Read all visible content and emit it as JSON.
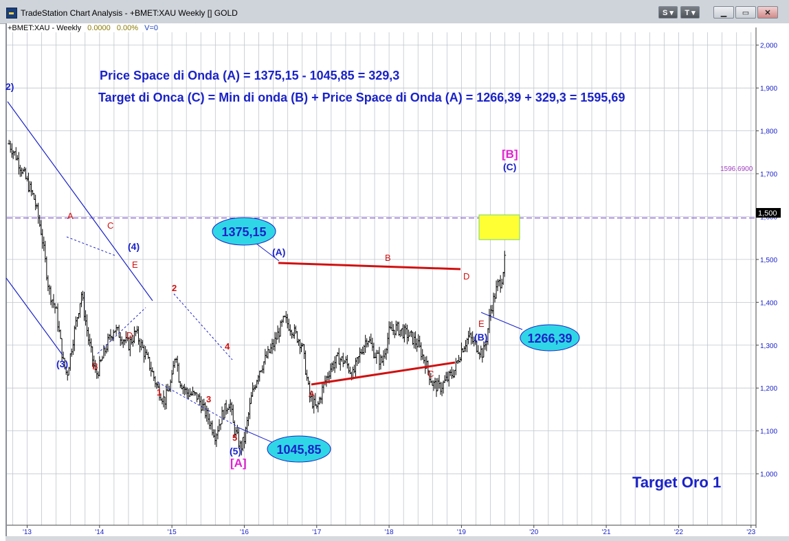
{
  "window": {
    "title": "TradeStation Chart Analysis - +BMET:XAU Weekly [] GOLD",
    "buttons": {
      "s_label": "S",
      "t_label": "T"
    }
  },
  "symbol_bar": {
    "symbol": "+BMET:XAU - Weekly",
    "price": "0.0000",
    "change": "0.00%",
    "volume": "V=0"
  },
  "colors": {
    "price_bars": "#000000",
    "grid": "#c0c4cc",
    "annotation_blue": "#1a22c8",
    "annotation_red": "#d01010",
    "annotation_magenta": "#e020d0",
    "target_line": "#8a5ad8",
    "bubble_fill": "#2fd7e6",
    "highlight_box": "#ffff33"
  },
  "annotations": {
    "formula1": "Price Space di Onda (A) = 1375,15 - 1045,85 = 329,3",
    "formula2": "Target di Onca (C) = Min di onda (B) + Price Space di Onda (A) =   1266,39 + 329,3 = 1595,69",
    "target_label": "Target Oro 1",
    "target_line_label": "1596.6900",
    "last_price_tag": "1,500",
    "bubbles": {
      "b1375": "1375,15",
      "b1045": "1045,85",
      "b1266": "1266,39"
    },
    "wave_labels": {
      "w2_top": "2)",
      "w3": "(3)",
      "w4": "(4)",
      "w5": "(5)",
      "bigA": "[A]",
      "bigB": "[B]",
      "waveA": "(A)",
      "waveB": "(B)",
      "waveC": "(C)",
      "s_A": "A",
      "s_B": "B",
      "s_C": "C",
      "s_D": "D",
      "s_E": "E",
      "n1": "1",
      "n2": "2",
      "n3": "3",
      "n4": "4",
      "n5": "5",
      "t_A": "A",
      "t_B": "B",
      "t_C": "C",
      "t_D": "D",
      "t_E": "E"
    }
  },
  "chart_data": {
    "type": "bar",
    "title": "",
    "symbol": "+BMET:XAU",
    "interval": "Weekly",
    "ylabel": "",
    "xlabel": "",
    "ylim": [
      880,
      2030
    ],
    "y_ticks": [
      1000,
      1100,
      1200,
      1300,
      1400,
      1500,
      1600,
      1700,
      1800,
      1900,
      2000
    ],
    "y_tick_labels": [
      "1,000",
      "1,100",
      "1,200",
      "1,300",
      "1,400",
      "1,500",
      "1,600",
      "1,700",
      "1,800",
      "1,900",
      "2,000"
    ],
    "x_ticks": [
      2013,
      2014,
      2015,
      2016,
      2017,
      2018,
      2019,
      2020,
      2021,
      2022,
      2023
    ],
    "x_tick_labels": [
      "'13",
      "'14",
      "'15",
      "'16",
      "'17",
      "'18",
      "'19",
      "'20",
      "'21",
      "'22",
      "'23"
    ],
    "xlim": [
      2012.72,
      2023.05
    ],
    "grid": true,
    "target_level": 1596.69,
    "price_path": [
      [
        2012.75,
        1770
      ],
      [
        2012.85,
        1740
      ],
      [
        2013.0,
        1680
      ],
      [
        2013.1,
        1640
      ],
      [
        2013.2,
        1560
      ],
      [
        2013.3,
        1430
      ],
      [
        2013.4,
        1380
      ],
      [
        2013.5,
        1260
      ],
      [
        2013.55,
        1230
      ],
      [
        2013.65,
        1330
      ],
      [
        2013.75,
        1420
      ],
      [
        2013.85,
        1310
      ],
      [
        2013.95,
        1230
      ],
      [
        2014.0,
        1250
      ],
      [
        2014.1,
        1300
      ],
      [
        2014.2,
        1340
      ],
      [
        2014.3,
        1320
      ],
      [
        2014.4,
        1300
      ],
      [
        2014.5,
        1330
      ],
      [
        2014.6,
        1290
      ],
      [
        2014.7,
        1250
      ],
      [
        2014.8,
        1200
      ],
      [
        2014.9,
        1170
      ],
      [
        2015.0,
        1220
      ],
      [
        2015.05,
        1290
      ],
      [
        2015.1,
        1220
      ],
      [
        2015.2,
        1190
      ],
      [
        2015.35,
        1180
      ],
      [
        2015.5,
        1130
      ],
      [
        2015.6,
        1090
      ],
      [
        2015.7,
        1140
      ],
      [
        2015.8,
        1170
      ],
      [
        2015.85,
        1110
      ],
      [
        2015.95,
        1060
      ],
      [
        2016.0,
        1080
      ],
      [
        2016.1,
        1180
      ],
      [
        2016.2,
        1240
      ],
      [
        2016.3,
        1270
      ],
      [
        2016.4,
        1300
      ],
      [
        2016.5,
        1340
      ],
      [
        2016.55,
        1360
      ],
      [
        2016.65,
        1340
      ],
      [
        2016.8,
        1300
      ],
      [
        2016.9,
        1180
      ],
      [
        2017.0,
        1150
      ],
      [
        2017.1,
        1210
      ],
      [
        2017.2,
        1250
      ],
      [
        2017.3,
        1270
      ],
      [
        2017.4,
        1260
      ],
      [
        2017.5,
        1230
      ],
      [
        2017.6,
        1280
      ],
      [
        2017.7,
        1320
      ],
      [
        2017.8,
        1280
      ],
      [
        2017.9,
        1260
      ],
      [
        2018.0,
        1330
      ],
      [
        2018.1,
        1340
      ],
      [
        2018.2,
        1330
      ],
      [
        2018.3,
        1320
      ],
      [
        2018.4,
        1300
      ],
      [
        2018.5,
        1260
      ],
      [
        2018.6,
        1210
      ],
      [
        2018.7,
        1200
      ],
      [
        2018.8,
        1220
      ],
      [
        2018.9,
        1240
      ],
      [
        2019.0,
        1290
      ],
      [
        2019.1,
        1320
      ],
      [
        2019.2,
        1300
      ],
      [
        2019.3,
        1280
      ],
      [
        2019.35,
        1320
      ],
      [
        2019.4,
        1380
      ],
      [
        2019.45,
        1410
      ],
      [
        2019.5,
        1440
      ],
      [
        2019.55,
        1450
      ],
      [
        2019.6,
        1500
      ]
    ]
  }
}
